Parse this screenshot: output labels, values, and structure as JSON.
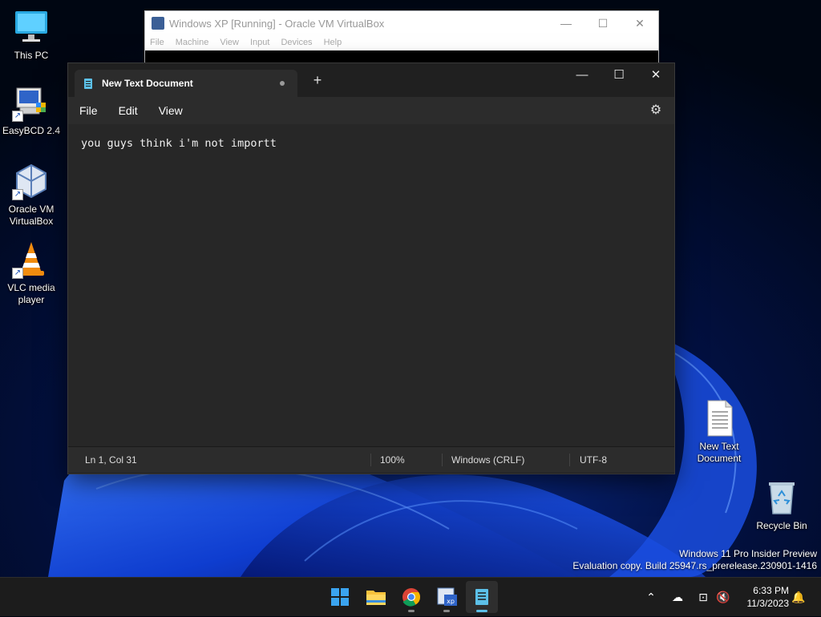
{
  "desktop": {
    "icons": [
      {
        "label": "This PC",
        "icon": "monitor-icon"
      },
      {
        "label": "EasyBCD 2.4",
        "icon": "easybcd-icon"
      },
      {
        "label": "Oracle VM VirtualBox",
        "icon": "virtualbox-icon"
      },
      {
        "label": "VLC media player",
        "icon": "vlc-icon"
      },
      {
        "label": "New Text Document",
        "icon": "text-document-icon"
      },
      {
        "label": "Recycle Bin",
        "icon": "recycle-bin-icon"
      }
    ]
  },
  "virtualbox": {
    "title": "Windows XP [Running] - Oracle VM VirtualBox",
    "menu": [
      "File",
      "Machine",
      "View",
      "Input",
      "Devices",
      "Help"
    ]
  },
  "notepad": {
    "tab_title": "New Text Document",
    "menu": [
      "File",
      "Edit",
      "View"
    ],
    "content": "you guys think i'm not importt",
    "status": {
      "position": "Ln 1, Col 31",
      "zoom": "100%",
      "line_ending": "Windows (CRLF)",
      "encoding": "UTF-8"
    }
  },
  "watermark": {
    "line1": "Windows 11 Pro Insider Preview",
    "line2": "Evaluation copy. Build 25947.rs_prerelease.230901-1416"
  },
  "taskbar": {
    "apps": [
      "start-icon",
      "file-explorer-icon",
      "chrome-icon",
      "windows-xp-vm-icon",
      "notepad-icon"
    ],
    "clock": {
      "time": "6:33 PM",
      "date": "11/3/2023"
    }
  },
  "colors": {
    "accent": "#5cc0e8",
    "editor_bg": "#272727",
    "taskbar_bg": "#1c1c1c"
  }
}
